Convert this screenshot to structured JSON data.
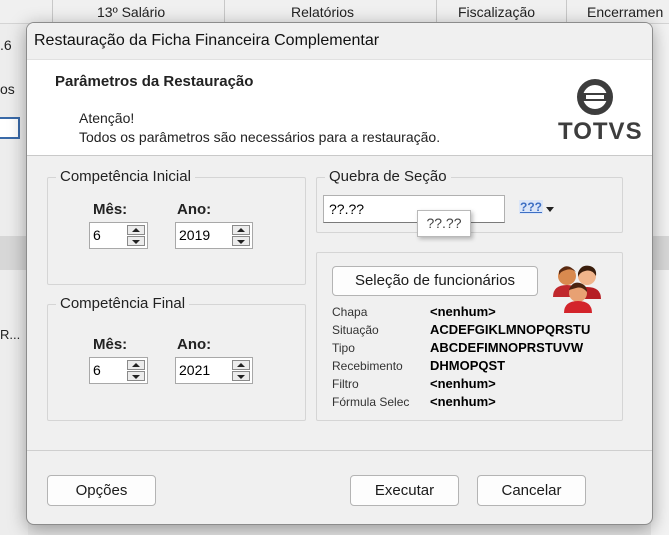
{
  "background": {
    "tabs": [
      "13º Salário",
      "Relatórios",
      "Fiscalização",
      "Encerramen"
    ],
    "left_texts": [
      ".6",
      "os",
      "R..."
    ]
  },
  "dialog": {
    "title": "Restauração da Ficha Financeira Complementar",
    "header": {
      "heading": "Parâmetros da Restauração",
      "warning": "Atenção!",
      "message": "Todos os parâmetros são necessários para a restauração.",
      "logo_text": "TOTVS"
    },
    "competencia_inicial": {
      "label": "Competência Inicial",
      "mes_label": "Mês:",
      "ano_label": "Ano:",
      "mes_value": "6",
      "ano_value": "2019"
    },
    "competencia_final": {
      "label": "Competência Final",
      "mes_label": "Mês:",
      "ano_label": "Ano:",
      "mes_value": "6",
      "ano_value": "2021"
    },
    "quebra_secao": {
      "label": "Quebra de Seção",
      "value": "??.??",
      "tooltip": "??.??",
      "dropdown_glyph": "???"
    },
    "selecao": {
      "button_label": "Seleção de funcionários",
      "rows": [
        {
          "key": "Chapa",
          "value": "<nenhum>"
        },
        {
          "key": "Situação",
          "value": "ACDEFGIKLMNOPQRSTU"
        },
        {
          "key": "Tipo",
          "value": "ABCDEFIMNOPRSTUVW"
        },
        {
          "key": "Recebimento",
          "value": "DHMOPQST"
        },
        {
          "key": "Filtro",
          "value": "<nenhum>"
        },
        {
          "key": "Fórmula Selec",
          "value": "<nenhum>"
        }
      ]
    },
    "buttons": {
      "opcoes": "Opções",
      "executar": "Executar",
      "cancelar": "Cancelar"
    }
  },
  "colors": {
    "dialog_bg": "#f0f0f0",
    "header_bg": "#ffffff",
    "logo": "#3d3d3d",
    "dropdown_glyph": "#3d6fc3"
  }
}
